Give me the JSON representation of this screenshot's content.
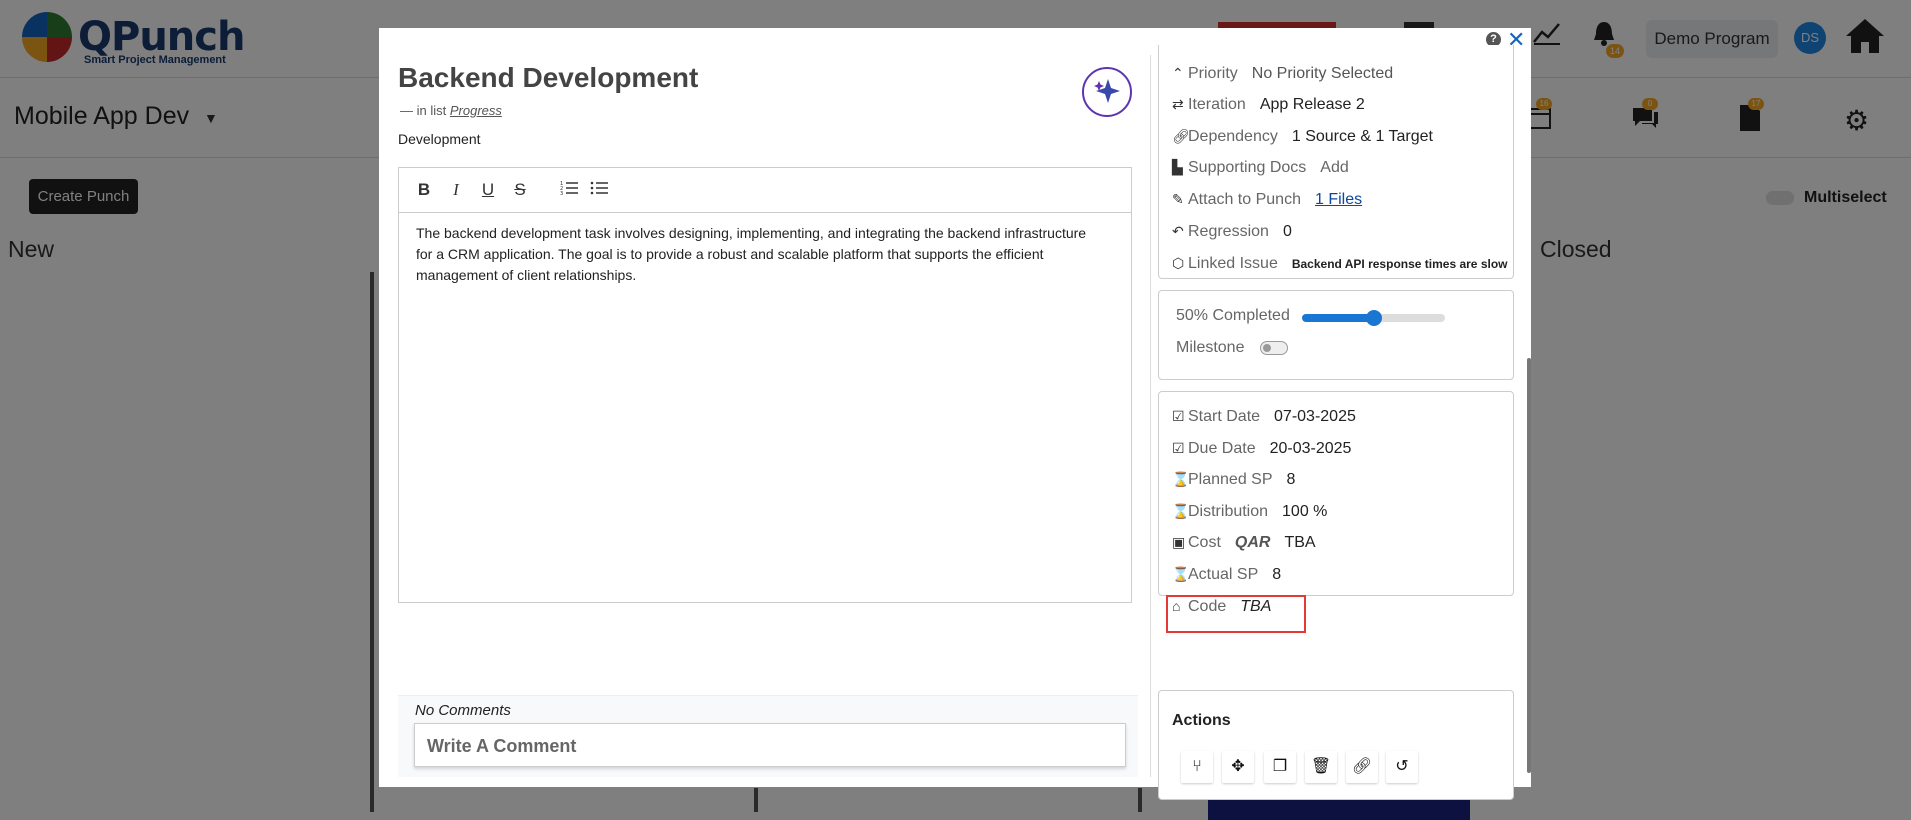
{
  "background": {
    "logo": {
      "name": "QPunch",
      "tagline": "Smart Project Management"
    },
    "bell_badge": "14",
    "demo_program": "Demo Program",
    "avatar_initials": "DS",
    "project_name": "Mobile App Dev",
    "sub_badges": [
      "16",
      "0",
      "17"
    ],
    "create_button": "Create Punch",
    "multiselect_label": "Multiselect",
    "columns": [
      "New",
      "Closed"
    ]
  },
  "modal": {
    "help_label": "?",
    "close_label": "✕",
    "title": "Backend Development",
    "in_list_prefix": "—  in list",
    "list_name": "Progress",
    "type": "Development",
    "editor": {
      "toolbar": [
        "B",
        "I",
        "U",
        "S"
      ],
      "body": "The backend development task involves designing, implementing, and integrating the backend infrastructure for a CRM application. The goal is to provide a robust and scalable platform that supports the efficient management of client relationships."
    },
    "comments": {
      "none_label": "No Comments",
      "placeholder": "Write A Comment"
    },
    "details": {
      "priority": {
        "label": "Priority",
        "value": "No Priority Selected"
      },
      "iteration": {
        "label": "Iteration",
        "value": "App Release 2"
      },
      "dependency": {
        "label": "Dependency",
        "value": "1 Source & 1 Target"
      },
      "supporting_docs": {
        "label": "Supporting Docs",
        "value": "Add"
      },
      "attach": {
        "label": "Attach to Punch",
        "value": "1 Files"
      },
      "regression": {
        "label": "Regression",
        "value": "0"
      },
      "linked_issue": {
        "label": "Linked Issue",
        "value": "Backend API response times are slow"
      }
    },
    "progress": {
      "completed_label": "50% Completed",
      "percent": 50,
      "milestone_label": "Milestone",
      "milestone_on": false
    },
    "schedule": {
      "start_date": {
        "label": "Start Date",
        "value": "07-03-2025"
      },
      "due_date": {
        "label": "Due Date",
        "value": "20-03-2025"
      },
      "planned_sp": {
        "label": "Planned SP",
        "value": "8"
      },
      "distribution": {
        "label": "Distribution",
        "value": "100 %"
      },
      "cost": {
        "label": "Cost",
        "currency": "QAR",
        "value": "TBA"
      },
      "actual_sp": {
        "label": "Actual SP",
        "value": "8"
      },
      "code": {
        "label": "Code",
        "value": "TBA"
      }
    },
    "actions": {
      "title": "Actions",
      "buttons": [
        "fork-icon",
        "move-icon",
        "copy-icon",
        "trash-icon",
        "link-icon",
        "history-icon"
      ]
    }
  }
}
